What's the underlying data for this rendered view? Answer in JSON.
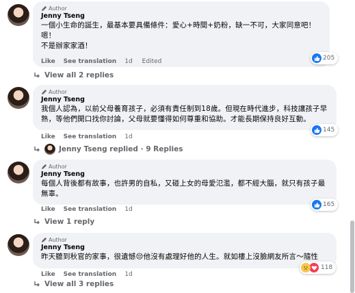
{
  "comments": [
    {
      "author_badge": "Author",
      "name": "Jenny Tseng",
      "text": "一個小生命的誕生，最基本要具備條件：愛心+時間+奶粉，缺一不可，大家同意吧！\n嗯！\n不是辦家家酒！",
      "reactions": "205",
      "like": "Like",
      "translate": "See translation",
      "time": "1d",
      "edited": "Edited",
      "replies": "View all 2 replies"
    },
    {
      "author_badge": "Author",
      "name": "Jenny Tseng",
      "text": "我個人認為，以前父母養育孩子，必須有責任制到18歲。但現在時代進步，科技讓孩子早熟，等他們開口找你討論，父母就要懂得如何尊重和協助。才能長期保持良好互動。",
      "reactions": "145",
      "like": "Like",
      "translate": "See translation",
      "time": "1d",
      "replies": "Jenny Tseng replied · 9 Replies"
    },
    {
      "author_badge": "Author",
      "name": "Jenny Tseng",
      "text": "每個人背後都有故事，也許男的自私，又碰上女的母愛氾濫，都不經大腦，就只有孩子最無辜。",
      "reactions": "165",
      "like": "Like",
      "translate": "See translation",
      "time": "1d",
      "replies": "View 1 reply"
    },
    {
      "author_badge": "Author",
      "name": "Jenny Tseng",
      "text": "昨天聽到秋官的家事，很遺憾😔他沒有處理好他的人生。就如樓上沒臉網友所言～隨性",
      "reactions": "118",
      "like": "Like",
      "translate": "See translation",
      "time": "1d",
      "replies": "View all 3 replies"
    }
  ],
  "colors": {
    "bubble": "#f0f2f5",
    "secondary_text": "#65676b",
    "like_blue": "#1877f2",
    "love_red": "#f33e58",
    "care_yellow": "#f7c64a"
  },
  "icons": [
    "pen-author-icon",
    "like-reaction-icon",
    "sad-reaction-icon",
    "love-reaction-icon",
    "reply-arrow-icon"
  ]
}
